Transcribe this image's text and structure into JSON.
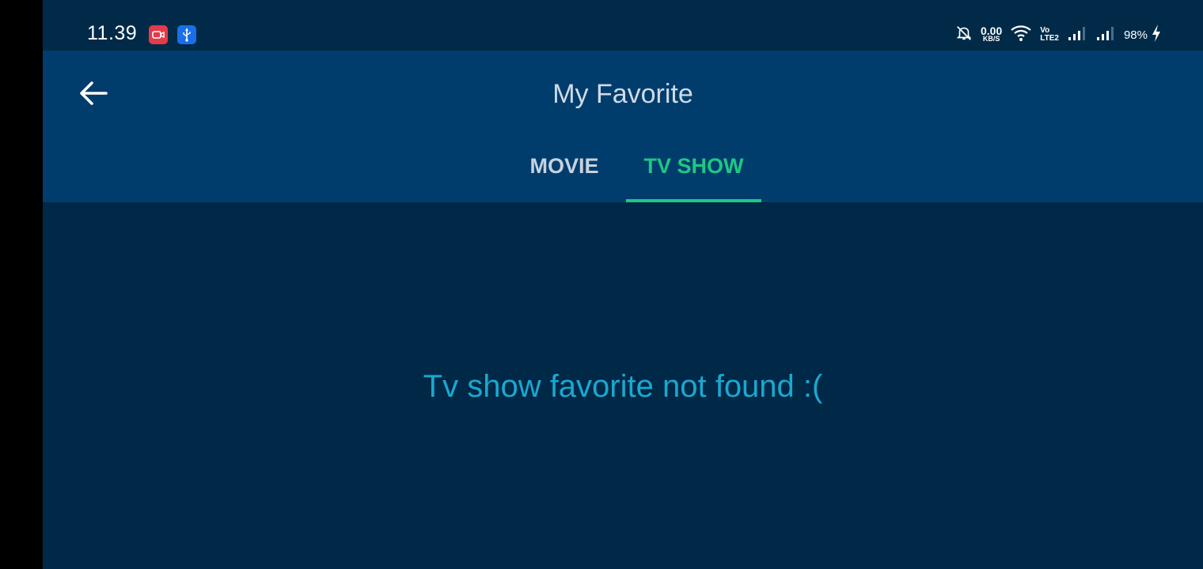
{
  "status_bar": {
    "time": "11.39",
    "net_speed_value": "0.00",
    "net_speed_unit": "KB/S",
    "volte_top": "Vo",
    "volte_bottom": "LTE2",
    "battery": "98%",
    "icons": [
      "screen-record-icon",
      "usb-icon",
      "mute-bell-icon",
      "wifi-icon",
      "signal-icon",
      "signal-icon",
      "charging-icon"
    ]
  },
  "app_bar": {
    "title": "My Favorite",
    "back_icon": "arrow-left-icon"
  },
  "tabs": [
    {
      "label": "MOVIE",
      "selected": false
    },
    {
      "label": "TV SHOW",
      "selected": true
    }
  ],
  "content": {
    "empty_message": "Tv show favorite not found :("
  },
  "colors": {
    "background": "#002847",
    "app_bar": "#003d6d",
    "accent": "#1ec882",
    "message": "#1aa8cf"
  }
}
